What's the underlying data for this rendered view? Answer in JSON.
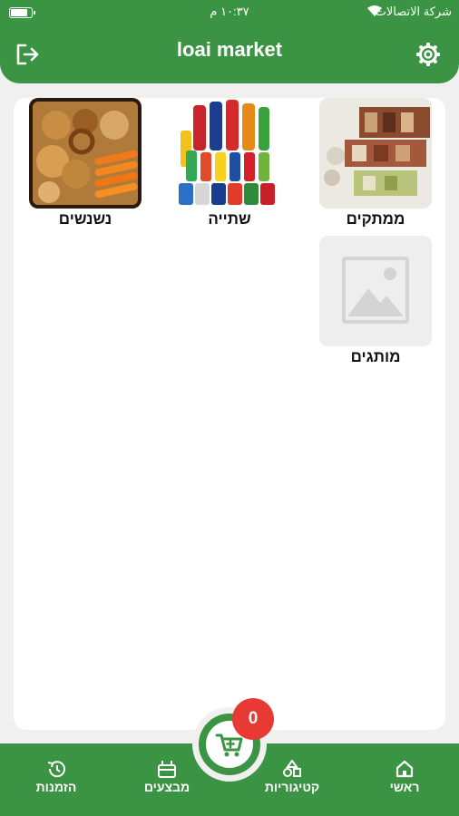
{
  "status_bar": {
    "carrier": "شركة الاتصالات",
    "time": "١٠:٣٧ م"
  },
  "app_bar": {
    "title": "loai market",
    "logout_icon": "logout-icon",
    "settings_icon": "gear-icon"
  },
  "categories": [
    {
      "label": "ממתקים",
      "image": "sweets-photo"
    },
    {
      "label": "שתייה",
      "image": "drinks-photo"
    },
    {
      "label": "נשנשים",
      "image": "snacks-photo"
    },
    {
      "label": "מותגים",
      "image": "image-placeholder"
    }
  ],
  "cart": {
    "count": "0",
    "icon": "cart-icon"
  },
  "bottom_nav": {
    "items": [
      {
        "label": "ראשי",
        "icon": "home-icon"
      },
      {
        "label": "קטיגוריות",
        "icon": "shapes-icon"
      },
      {
        "label": "מבצעים",
        "icon": "deals-icon"
      },
      {
        "label": "הזמנות",
        "icon": "history-icon"
      }
    ]
  },
  "colors": {
    "primary": "#3b9443",
    "badge": "#e83a34",
    "background": "#f0f0f0"
  }
}
